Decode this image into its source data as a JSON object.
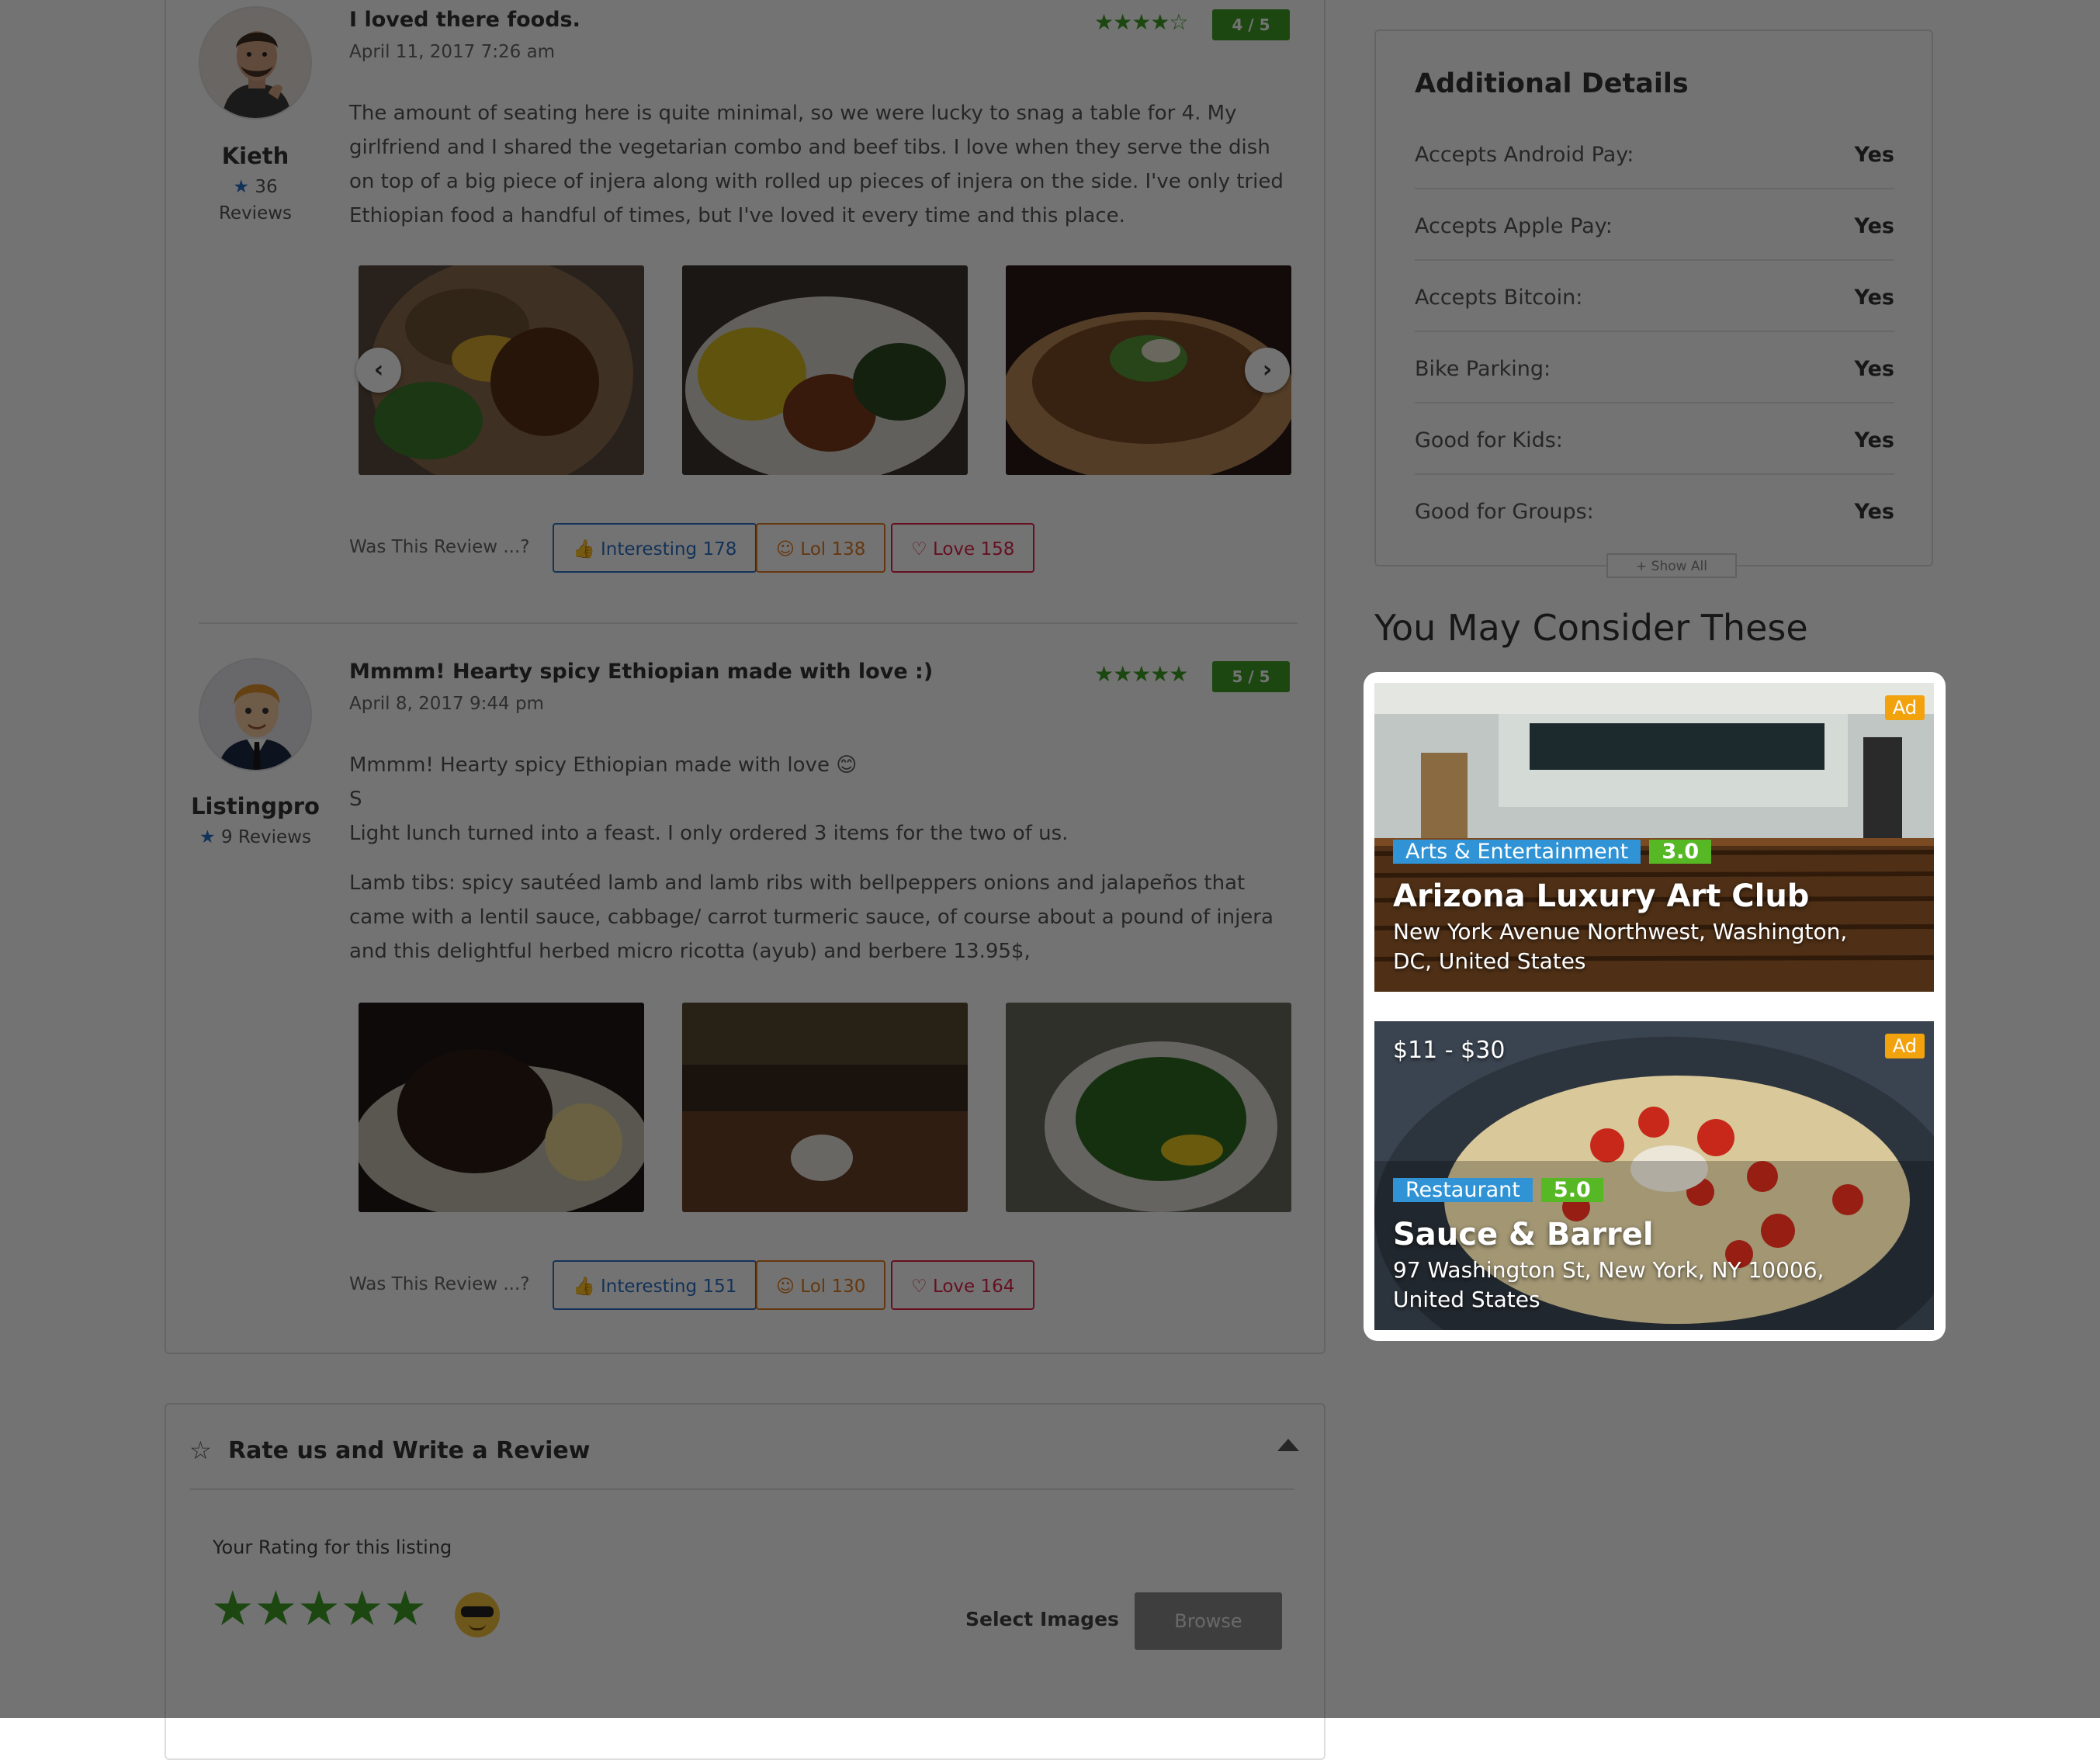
{
  "reviews": [
    {
      "author": "Kieth",
      "author_reviews_count": "36",
      "author_reviews_label": "Reviews",
      "title": "I loved there foods.",
      "date": "April 11, 2017 7:26 am",
      "stars_text": "★★★★☆",
      "rating_badge": "4 / 5",
      "paragraphs": [
        "The amount of seating here is quite minimal, so we were lucky to snag a table for 4. My girlfriend and I shared the vegetarian combo and beef tibs. I love when they serve the dish on top of a big piece of injera along with rolled up pieces of injera on the side. I've only tried Ethiopian food a handful of times, but I've loved it every time and this place."
      ],
      "was_label": "Was This Review ...?",
      "interesting": "Interesting 178",
      "lol": "Lol 138",
      "love": "Love 158"
    },
    {
      "author": "Listingpro",
      "author_reviews_count": "9",
      "author_reviews_label": "Reviews",
      "title": "Mmmm! Hearty spicy Ethiopian made with love :)",
      "date": "April 8, 2017 9:44 pm",
      "stars_text": "★★★★★",
      "rating_badge": "5 / 5",
      "paragraphs": [
        "Mmmm! Hearty spicy Ethiopian made with love 😊",
        "S",
        "Light lunch turned into a feast. I only ordered 3 items for the two of us.",
        "Lamb tibs: spicy sautéed lamb and lamb ribs with bellpeppers onions and jalapeños that came with a lentil sauce, cabbage/ carrot turmeric sauce, of course about a pound of injera and this delightful herbed micro ricotta (ayub) and berbere 13.95$,"
      ],
      "was_label": "Was This Review ...?",
      "interesting": "Interesting 151",
      "lol": "Lol 130",
      "love": "Love 164"
    }
  ],
  "write_review": {
    "title": "Rate us and Write a Review",
    "rating_label": "Your Rating for this listing",
    "select_images": "Select Images",
    "browse": "Browse"
  },
  "details": {
    "title": "Additional Details",
    "rows": [
      {
        "label": "Accepts Android Pay:",
        "value": "Yes"
      },
      {
        "label": "Accepts Apple Pay:",
        "value": "Yes"
      },
      {
        "label": "Accepts Bitcoin:",
        "value": "Yes"
      },
      {
        "label": "Bike Parking:",
        "value": "Yes"
      },
      {
        "label": "Good for Kids:",
        "value": "Yes"
      },
      {
        "label": "Good for Groups:",
        "value": "Yes"
      }
    ],
    "show_all": "+ Show All"
  },
  "consider": {
    "title": "You May Consider These",
    "ads": [
      {
        "badge": "Ad",
        "category": "Arts & Entertainment",
        "score": "3.0",
        "name": "Arizona Luxury Art Club",
        "address": "New York Avenue Northwest, Washington, DC, United States"
      },
      {
        "badge": "Ad",
        "price": "$11 - $30",
        "category": "Restaurant",
        "score": "5.0",
        "name": "Sauce & Barrel",
        "address": "97 Washington St, New York, NY 10006, United States"
      }
    ]
  },
  "colors": {
    "overlay": "#000000",
    "rating_green": "#3e9e26",
    "category_blue": "#2f93d6",
    "score_green": "#57b826",
    "ad_orange": "#f2a20d"
  }
}
